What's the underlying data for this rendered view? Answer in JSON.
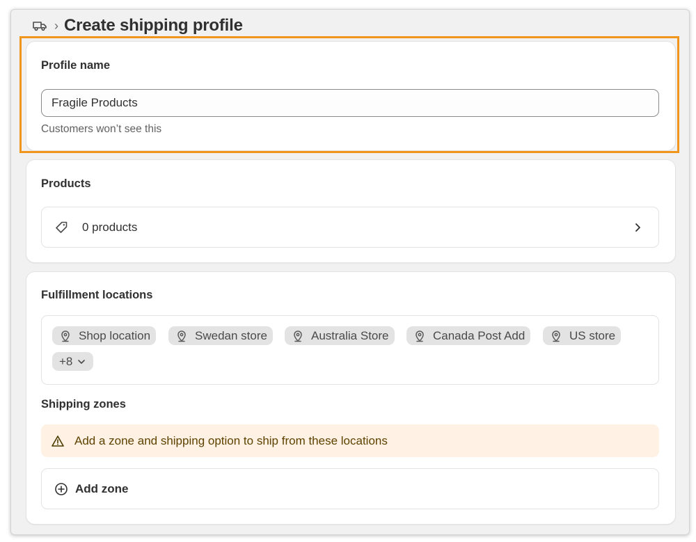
{
  "header": {
    "icon": "truck-icon",
    "separator": "›",
    "title": "Create shipping profile"
  },
  "profile": {
    "label": "Profile name",
    "value": "Fragile Products",
    "help": "Customers won’t see this"
  },
  "products": {
    "label": "Products",
    "count_text": "0 products"
  },
  "fulfillment": {
    "label": "Fulfillment locations",
    "locations": [
      "Shop location",
      "Swedan store",
      "Australia Store",
      "Canada Post Add",
      "US store"
    ],
    "more": "+8"
  },
  "zones": {
    "label": "Shipping zones",
    "warning": "Add a zone and shipping option to ship from these locations",
    "add_label": "Add zone"
  },
  "colors": {
    "highlight": "#f0961c",
    "warning_bg": "#fff1e3",
    "chip_bg": "#e3e3e3"
  }
}
